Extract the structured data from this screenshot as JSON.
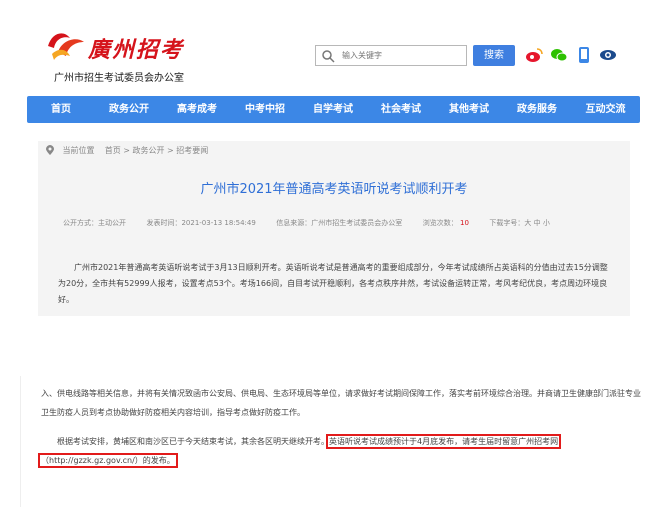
{
  "header": {
    "logo_text": "廣州招考",
    "subtitle": "广州市招生考试委员会办公室"
  },
  "search": {
    "placeholder": "输入关键字",
    "button": "搜索"
  },
  "tools": [
    "weibo-icon",
    "wechat-icon",
    "mobile-icon",
    "eye-icon"
  ],
  "nav": {
    "items": [
      "首页",
      "政务公开",
      "高考成考",
      "中考中招",
      "自学考试",
      "社会考试",
      "其他考试",
      "政务服务",
      "互动交流"
    ]
  },
  "breadcrumb": {
    "label": "当前位置",
    "path": "首页 > 政务公开 > 招考要闻"
  },
  "article": {
    "title": "广州市2021年普通高考英语听说考试顺利开考",
    "meta": {
      "public_way": "公开方式：主动公开",
      "publish_time": "发表时间：2021-03-13 18:54:49",
      "source": "信息来源：广州市招生考试委员会办公室",
      "views_label": "浏览次数：",
      "views": "10",
      "font_size": "下载字号：大 中 小"
    },
    "para1": "广州市2021年普通高考英语听说考试于3月13日顺利开考。英语听说考试是普通高考的重要组成部分，今年考试成绩所占英语科的分值由过去15分调整为20分，全市共有52999人报考，设置考点53个。考场166间，自目考试开稳顺利，各考点秩序井然，考试设备运转正常，考风考纪优良，考点周边环境良好。",
    "para2": "入、供电线路等相关信息，并将有关情况致函市公安局、供电局、生态环境局等单位，请求做好考试期间保障工作，落实考前环境综合治理。并商请卫生健康部门派驻专业卫生防疫人员到考点协助做好防疫相关内容培训，指导考点做好防疫工作。",
    "para3_a": "根据考试安排，黄埔区和南沙区已于今天结束考试，其余各区明天继续开考。",
    "para3_b": "英语听说考试成绩预计于4月底发布，请考生届时留意广州招考网（http://gzzk.gz.gov.cn/）的发布。"
  }
}
